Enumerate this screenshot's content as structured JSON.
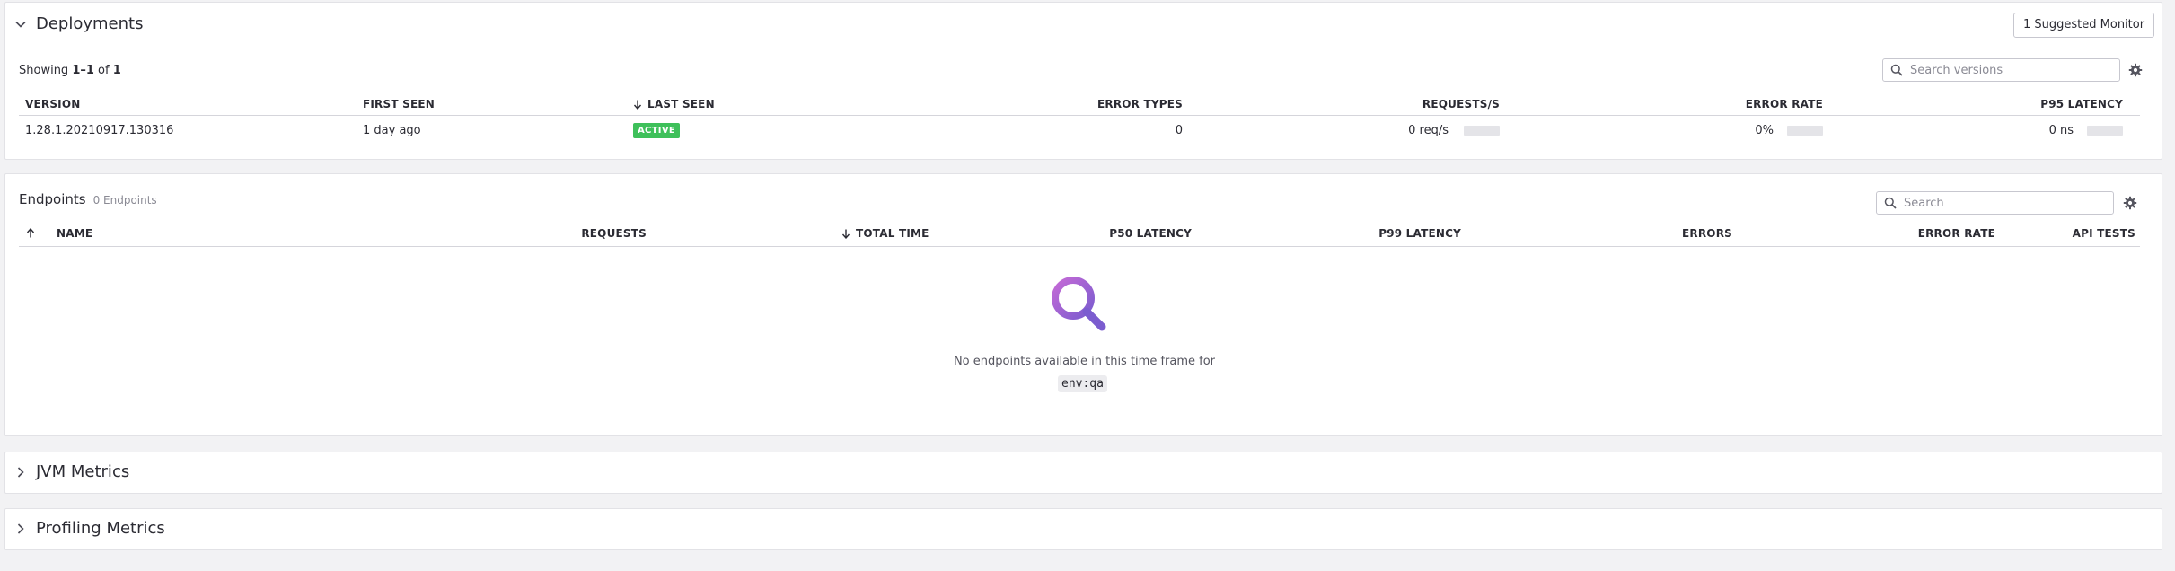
{
  "deployments": {
    "title": "Deployments",
    "suggested_monitor_label": "1 Suggested Monitor",
    "showing": {
      "prefix": "Showing ",
      "range": "1–1",
      "of": " of ",
      "total": "1"
    },
    "search_placeholder": "Search versions",
    "columns": [
      "VERSION",
      "FIRST SEEN",
      "LAST SEEN",
      "ERROR TYPES",
      "REQUESTS/S",
      "ERROR RATE",
      "P95 LATENCY"
    ],
    "sorted_column": "LAST SEEN",
    "rows": [
      {
        "version": "1.28.1.20210917.130316",
        "first_seen": "1 day ago",
        "last_seen_badge": "ACTIVE",
        "error_types": "0",
        "requests": "0 req/s",
        "error_rate": "0%",
        "p95_latency": "0 ns"
      }
    ]
  },
  "endpoints": {
    "title": "Endpoints",
    "count_label": "0 Endpoints",
    "search_placeholder": "Search",
    "columns": [
      "NAME",
      "REQUESTS",
      "TOTAL TIME",
      "P50 LATENCY",
      "P99 LATENCY",
      "ERRORS",
      "ERROR RATE",
      "API TESTS"
    ],
    "sorted_column": "TOTAL TIME",
    "empty_message": "No endpoints available in this time frame for",
    "empty_tag": "env:qa"
  },
  "jvm": {
    "title": "JVM Metrics"
  },
  "profiling": {
    "title": "Profiling Metrics"
  },
  "colors": {
    "active_badge": "#3ec05a",
    "empty_icon_start": "#c46ad6",
    "empty_icon_end": "#7b5ccf"
  }
}
